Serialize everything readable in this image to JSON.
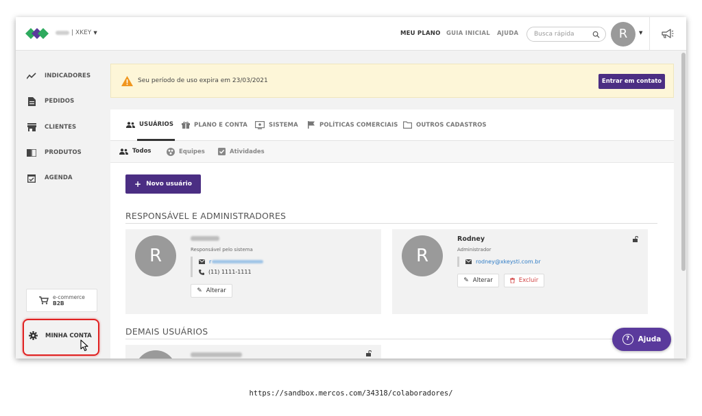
{
  "header": {
    "company_name": "XKEY",
    "nav": [
      "MEU PLANO",
      "GUIA INICIAL",
      "AJUDA"
    ],
    "search_placeholder": "Busca rápida",
    "avatar_initial": "R"
  },
  "sidebar": {
    "items": [
      "INDICADORES",
      "PEDIDOS",
      "CLIENTES",
      "PRODUTOS",
      "AGENDA"
    ],
    "ecommerce_label": "e-commerce",
    "ecommerce_sub": "B2B",
    "account_label": "MINHA CONTA"
  },
  "banner": {
    "message": "Seu período de uso expira em 23/03/2021",
    "button": "Entrar em contato"
  },
  "tabs": [
    "USUÁRIOS",
    "PLANO E CONTA",
    "SISTEMA",
    "POLÍTICAS COMERCIAIS",
    "OUTROS CADASTROS"
  ],
  "subtabs": [
    "Todos",
    "Equipes",
    "Atividades"
  ],
  "new_user_button": "Novo usuário",
  "sections": {
    "admins": "RESPONSÁVEL E ADMINISTRADORES",
    "others": "DEMAIS USUÁRIOS"
  },
  "users": [
    {
      "initial": "R",
      "name": "",
      "role": "Responsável pelo sistema",
      "email_visible": "r",
      "phone": "(11) 1111-1111",
      "edit": "Alterar"
    },
    {
      "initial": "R",
      "name": "Rodney",
      "role": "Administrador",
      "email": "rodney@xkeysti.com.br",
      "edit": "Alterar",
      "delete": "Excluir"
    }
  ],
  "help_button": "Ajuda",
  "footer_url": "https://sandbox.mercos.com/34318/colaboradores/",
  "colors": {
    "accent_purple": "#4b2e83",
    "logo_green": "#2eaa5e",
    "logo_purple": "#5a3a9c",
    "highlight_red": "#e02020",
    "warning_orange": "#f0961e",
    "link_blue": "#2f7cc6"
  }
}
